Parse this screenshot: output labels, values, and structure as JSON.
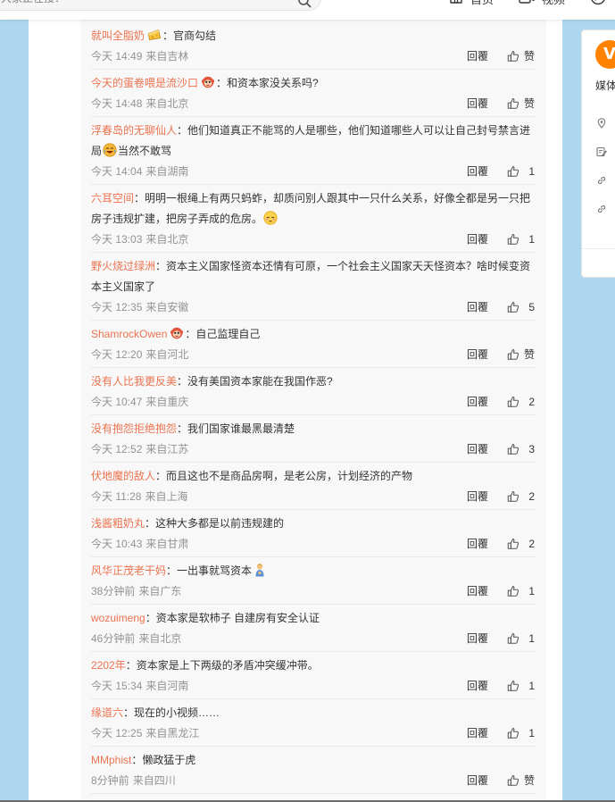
{
  "header": {
    "search": {
      "placeholder": "大家正在搜："
    },
    "nav": [
      {
        "label": "首页",
        "icon": "home-icon"
      },
      {
        "label": "视频",
        "icon": "video-icon"
      },
      {
        "icon": "compass-icon"
      }
    ]
  },
  "labels": {
    "reply": "回覆",
    "name_separator": "："
  },
  "comments": [
    {
      "user": "就叫全脂奶",
      "user_badge": "cheese",
      "lines": [
        [
          {
            "text": "官商勾结"
          }
        ]
      ],
      "time": "今天 14:49",
      "location": "来自吉林",
      "likes": "赞"
    },
    {
      "user": "今天的蛋卷喂是流沙口",
      "user_badge": "monkey",
      "lines": [
        [
          {
            "text": "和资本家没关系吗?"
          }
        ]
      ],
      "time": "今天 14:48",
      "location": "来自北京",
      "likes": "赞"
    },
    {
      "user": "浮春岛的无聊仙人",
      "lines": [
        [
          {
            "text": "他们知道真正不能骂的人是哪些，他们知道哪些人可以让自己封号禁言进"
          }
        ],
        [
          {
            "text": "局"
          },
          {
            "emoji": "laugh-cry"
          },
          {
            "text": "当然不敢骂"
          }
        ]
      ],
      "time": "今天 14:04",
      "location": "来自湖南",
      "likes": "1"
    },
    {
      "user": "六耳空间",
      "lines": [
        [
          {
            "text": "明明一根绳上有两只蚂蚱，却质问别人跟其中一只什么关系，好像全都是另一只把"
          }
        ],
        [
          {
            "text": "房子违规扩建，把房子弄成的危房。"
          },
          {
            "emoji": "blush"
          }
        ]
      ],
      "time": "今天 13:03",
      "location": "来自北京",
      "likes": "1"
    },
    {
      "user": "野火烧过绿洲",
      "lines": [
        [
          {
            "text": "资本主义国家怪资本还情有可原，一个社会主义国家天天怪资本？啥时候变资"
          }
        ],
        [
          {
            "text": "本主义国家了"
          }
        ]
      ],
      "time": "今天 12:35",
      "location": "来自安徽",
      "likes": "5"
    },
    {
      "user": "ShamrockOwen",
      "user_badge": "monkey",
      "lines": [
        [
          {
            "text": "自己监理自己"
          }
        ]
      ],
      "time": "今天 12:20",
      "location": "来自河北",
      "likes": "赞"
    },
    {
      "user": "没有人比我更反美",
      "lines": [
        [
          {
            "text": "没有美国资本家能在我国作恶?"
          }
        ]
      ],
      "time": "今天 10:47",
      "location": "来自重庆",
      "likes": "2"
    },
    {
      "user": "没有抱怨拒绝抱怨",
      "lines": [
        [
          {
            "text": "我们国家谁最黑最清楚"
          }
        ]
      ],
      "time": "今天 12:52",
      "location": "来自江苏",
      "likes": "3"
    },
    {
      "user": "伏地魔的敌人",
      "lines": [
        [
          {
            "text": "而且这也不是商品房啊，是老公房，计划经济的产物"
          }
        ]
      ],
      "time": "今天 11:28",
      "location": "来自上海",
      "likes": "2"
    },
    {
      "user": "浅酱粗奶丸",
      "lines": [
        [
          {
            "text": "这种大多都是以前违规建的"
          }
        ]
      ],
      "time": "今天 10:43",
      "location": "来自甘肃",
      "likes": "2"
    },
    {
      "user": "风华正茂老干妈",
      "lines": [
        [
          {
            "text": "一出事就骂资本"
          },
          {
            "emoji": "person"
          }
        ]
      ],
      "time": "38分钟前",
      "location": "来自广东",
      "likes": "1"
    },
    {
      "user": "wozuimeng",
      "lines": [
        [
          {
            "text": "资本家是软柿子 自建房有安全认证"
          }
        ]
      ],
      "time": "46分钟前",
      "location": "来自北京",
      "likes": "1"
    },
    {
      "user": "2202年",
      "lines": [
        [
          {
            "text": "资本家是上下两级的矛盾冲突缓冲带。"
          }
        ]
      ],
      "time": "今天 15:34",
      "location": "来自河南",
      "likes": "1"
    },
    {
      "user": "缘道六",
      "lines": [
        [
          {
            "text": "现在的小视频……"
          }
        ]
      ],
      "time": "今天 12:25",
      "location": "来自黑龙江",
      "likes": "1"
    },
    {
      "user": "MMphist",
      "lines": [
        [
          {
            "text": "懒政猛于虎"
          }
        ]
      ],
      "time": "8分钟前",
      "location": "来自四川",
      "likes": "赞"
    }
  ],
  "side_card": {
    "logo_letter": "V",
    "label": "媒体",
    "icons": [
      "location-icon",
      "edit-icon",
      "link-icon",
      "link-icon"
    ]
  },
  "colors": {
    "page_background": "#acd7ef",
    "username": "#eb7350",
    "text": "#333333",
    "meta": "#939393",
    "logo": "#ff8200"
  }
}
